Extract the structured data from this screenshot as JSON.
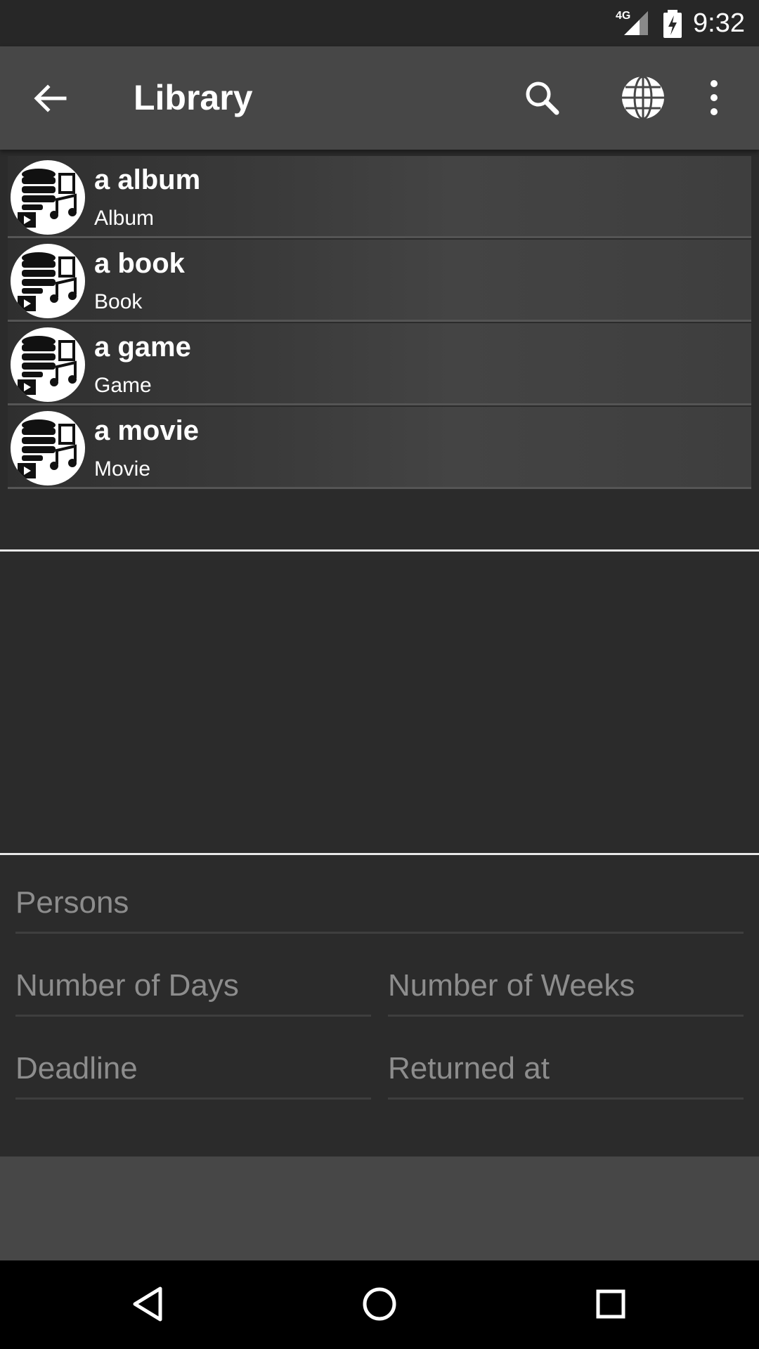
{
  "status_bar": {
    "network": "4G",
    "time": "9:32",
    "icons": [
      "signal-icon",
      "battery-charging-icon"
    ]
  },
  "app_bar": {
    "title": "Library",
    "icons": [
      "back-arrow-icon",
      "search-icon",
      "globe-icon",
      "more-vert-icon"
    ]
  },
  "items": [
    {
      "title": "a album",
      "type": "Album"
    },
    {
      "title": "a book",
      "type": "Book"
    },
    {
      "title": "a game",
      "type": "Game"
    },
    {
      "title": "a movie",
      "type": "Movie"
    }
  ],
  "form": {
    "persons_placeholder": "Persons",
    "days_placeholder": "Number of Days",
    "weeks_placeholder": "Number of Weeks",
    "deadline_placeholder": "Deadline",
    "returned_placeholder": "Returned at"
  },
  "nav_bar": {
    "icons": [
      "nav-back-icon",
      "nav-home-icon",
      "nav-recents-icon"
    ]
  },
  "colors": {
    "app_bar": "#474747",
    "background": "#2b2b2b",
    "status_bar": "#272727",
    "hint_text": "#8d8d8d"
  }
}
